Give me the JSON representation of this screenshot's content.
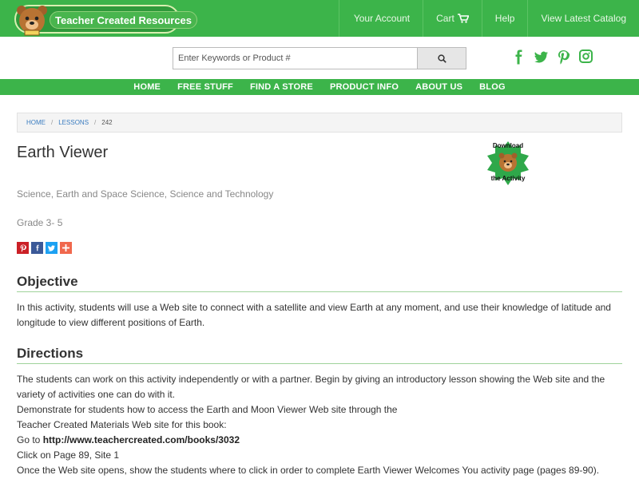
{
  "header": {
    "logo_text": "Teacher Created Resources",
    "nav": [
      {
        "label": "Your Account"
      },
      {
        "label": "Cart"
      },
      {
        "label": "Help"
      },
      {
        "label": "View Latest Catalog"
      }
    ]
  },
  "search": {
    "placeholder": "Enter Keywords or Product #"
  },
  "social_icons": [
    "facebook-icon",
    "twitter-icon",
    "pinterest-icon",
    "instagram-icon"
  ],
  "main_nav": [
    "HOME",
    "FREE STUFF",
    "FIND A STORE",
    "PRODUCT INFO",
    "ABOUT US",
    "BLOG"
  ],
  "breadcrumb": {
    "items": [
      "HOME",
      "LESSONS"
    ],
    "current": "242"
  },
  "lesson": {
    "title": "Earth Viewer",
    "download_line1": "Download",
    "download_line2": "the Activity",
    "subjects": "Science, Earth and Space Science, Science and Technology",
    "grade": "Grade 3- 5"
  },
  "share_icons": [
    "pinterest-share-icon",
    "facebook-share-icon",
    "twitter-share-icon",
    "plus-share-icon"
  ],
  "objective": {
    "heading": "Objective",
    "text": "In this activity, students will use a Web site to connect with a satellite and view Earth at any moment, and use their knowledge of latitude and longitude to view different positions of Earth."
  },
  "directions": {
    "heading": "Directions",
    "p1": "The students can work on this activity independently or with a partner. Begin by giving an introductory lesson showing the Web site and the variety of activities one can do with it.",
    "p2": "Demonstrate for students how to access the Earth and Moon Viewer Web site through the",
    "p3": "Teacher Created Materials Web site for this book:",
    "p4_prefix": "Go to ",
    "p4_link": "http://www.teachercreated.com/books/3032",
    "p5": "Click on Page 89, Site 1",
    "p6": "Once the Web site opens, show the students where to click in order to complete Earth Viewer Welcomes You activity page (pages 89-90)."
  },
  "colors": {
    "brand_green": "#3cb44a",
    "link_blue": "#3a7cc0"
  }
}
